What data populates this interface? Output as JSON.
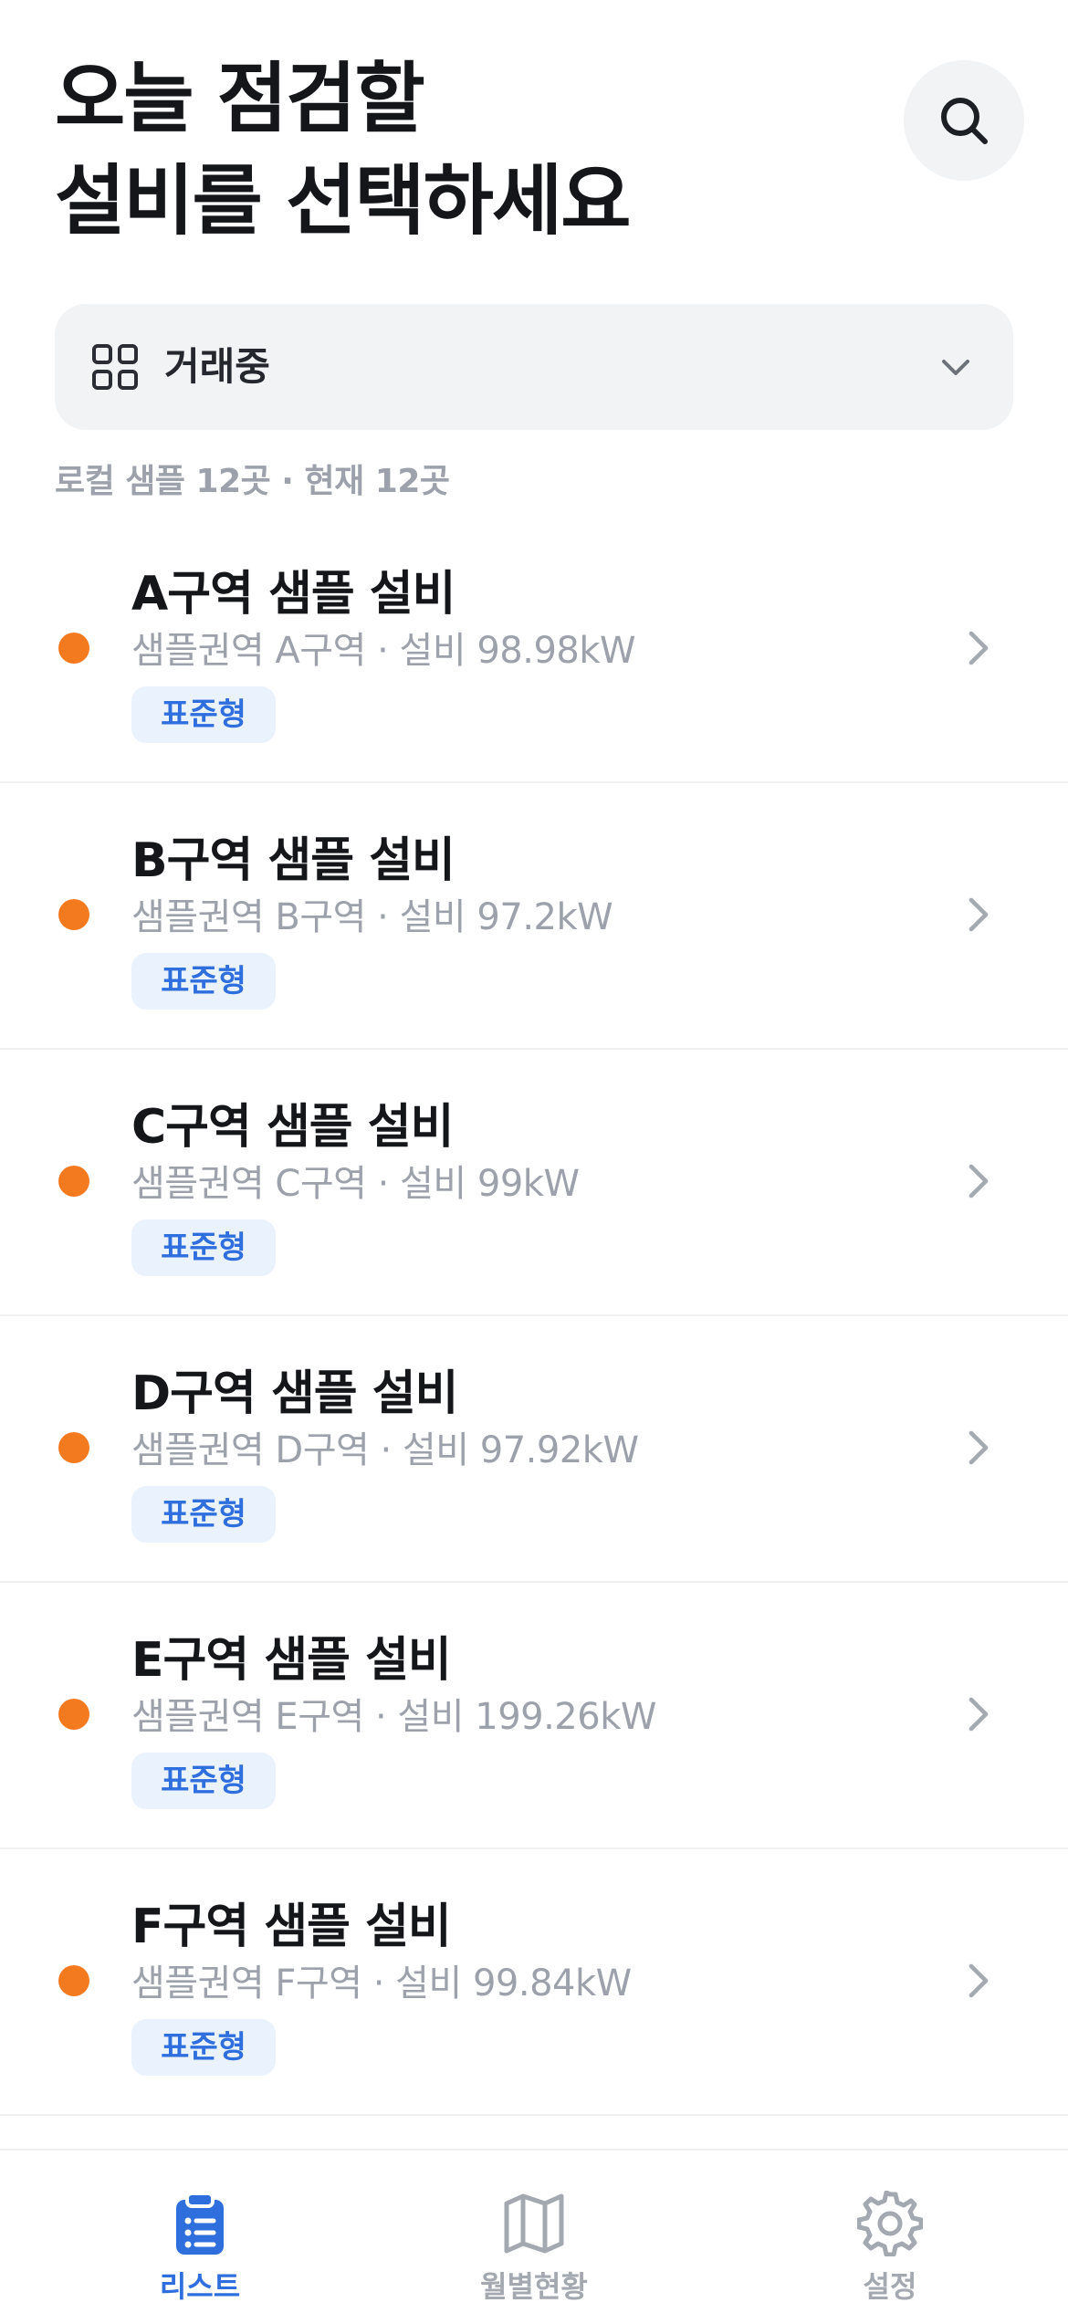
{
  "header": {
    "title_line1": "오늘 점검할",
    "title_line2": "설비를 선택하세요",
    "search_icon": "search-icon"
  },
  "filter": {
    "icon": "grid-icon",
    "label": "거래중",
    "chevron_icon": "chevron-down-icon"
  },
  "summary": {
    "text": "로컬 샘플 12곳 · 현재 12곳"
  },
  "colors": {
    "status_dot": "#f47a20",
    "badge_text": "#2f6fdd",
    "badge_bg": "#eaf2fe",
    "nav_active": "#2f6fdd",
    "nav_inactive": "#a3a8b1"
  },
  "facilities": [
    {
      "name": "A구역 샘플 설비",
      "subtitle": "샘플권역 A구역 · 설비 98.98kW",
      "badge": "표준형"
    },
    {
      "name": "B구역 샘플 설비",
      "subtitle": "샘플권역 B구역 · 설비 97.2kW",
      "badge": "표준형"
    },
    {
      "name": "C구역 샘플 설비",
      "subtitle": "샘플권역 C구역 · 설비 99kW",
      "badge": "표준형"
    },
    {
      "name": "D구역 샘플 설비",
      "subtitle": "샘플권역 D구역 · 설비 97.92kW",
      "badge": "표준형"
    },
    {
      "name": "E구역 샘플 설비",
      "subtitle": "샘플권역 E구역 · 설비 199.26kW",
      "badge": "표준형"
    },
    {
      "name": "F구역 샘플 설비",
      "subtitle": "샘플권역 F구역 · 설비 99.84kW",
      "badge": "표준형"
    }
  ],
  "nav": {
    "items": [
      {
        "label": "리스트",
        "icon": "clipboard-list-icon",
        "active": true
      },
      {
        "label": "월별현황",
        "icon": "map-icon",
        "active": false
      },
      {
        "label": "설정",
        "icon": "gear-icon",
        "active": false
      }
    ]
  }
}
